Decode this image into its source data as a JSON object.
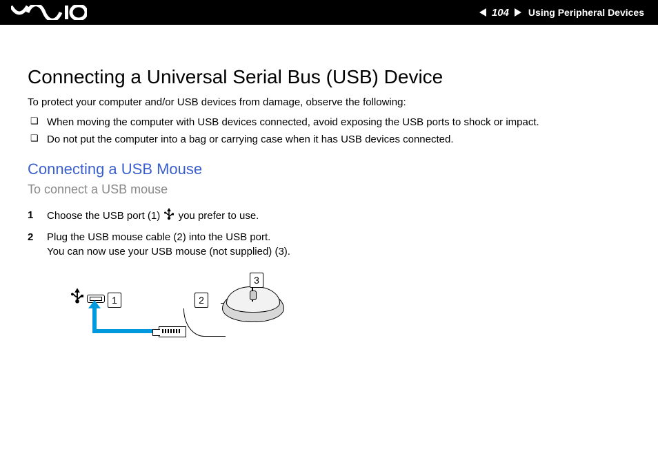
{
  "header": {
    "page_number": "104",
    "section": "Using Peripheral Devices"
  },
  "title": "Connecting a Universal Serial Bus (USB) Device",
  "intro": "To protect your computer and/or USB devices from damage, observe the following:",
  "bullets": [
    "When moving the computer with USB devices connected, avoid exposing the USB ports to shock or impact.",
    "Do not put the computer into a bag or carrying case when it has USB devices connected."
  ],
  "subtitle": "Connecting a USB Mouse",
  "subhead": "To connect a USB mouse",
  "steps": [
    {
      "num": "1",
      "pre": "Choose the USB port (1) ",
      "post": " you prefer to use."
    },
    {
      "num": "2",
      "pre": "Plug the USB mouse cable (2) into the USB port.",
      "post": "",
      "line2": "You can now use your USB mouse (not supplied) (3)."
    }
  ],
  "callouts": {
    "c1": "1",
    "c2": "2",
    "c3": "3"
  }
}
